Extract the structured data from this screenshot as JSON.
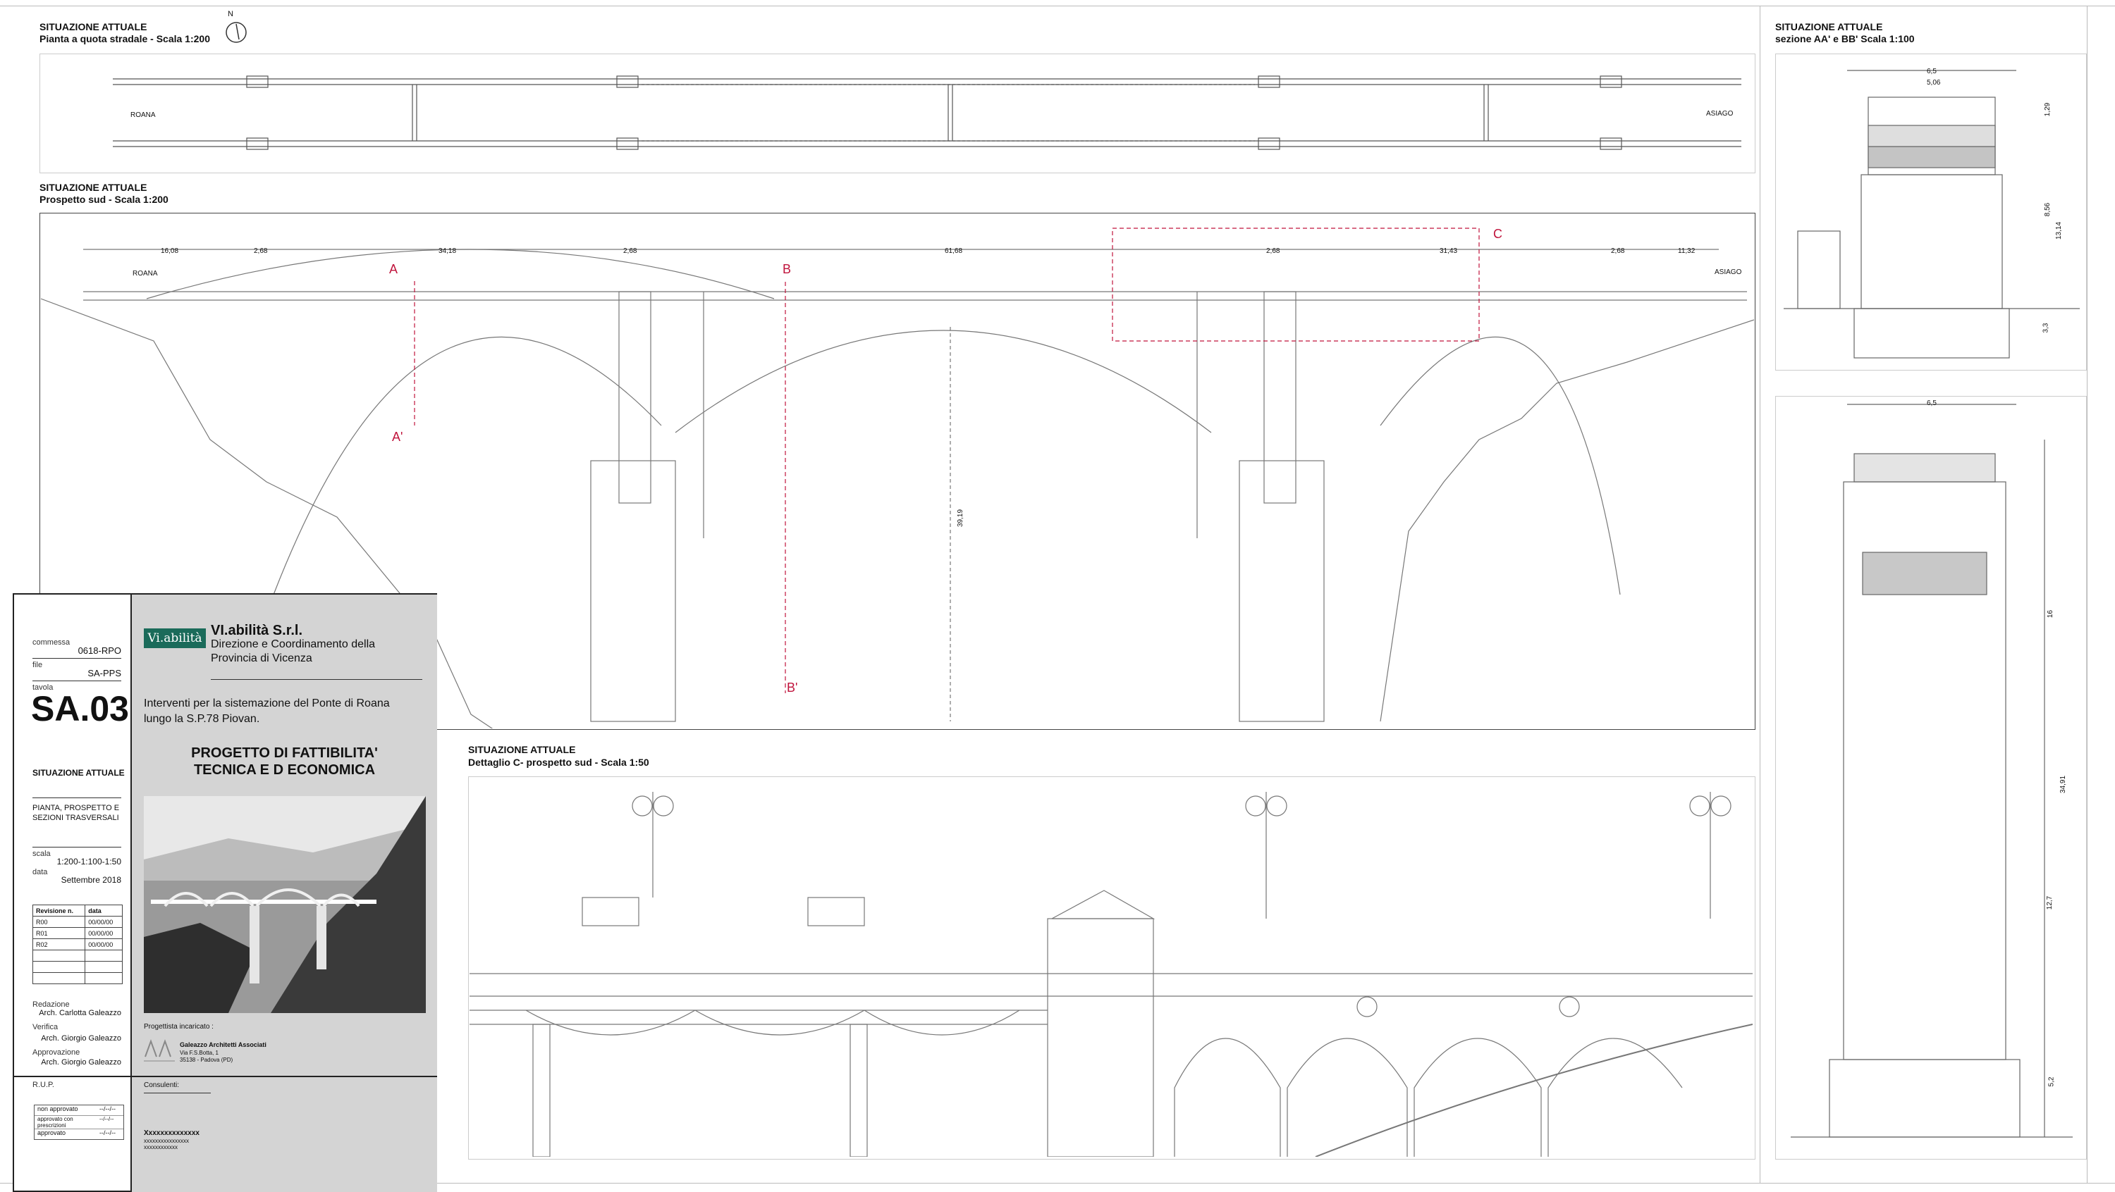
{
  "panels": {
    "plan": {
      "title": "SITUAZIONE ATTUALE",
      "subtitle": "Pianta a quota stradale - Scala 1:200",
      "left_label": "ROANA",
      "right_label": "ASIAGO",
      "north": "N"
    },
    "elevation": {
      "title": "SITUAZIONE ATTUALE",
      "subtitle": "Prospetto sud - Scala 1:200",
      "left_label": "ROANA",
      "right_label": "ASIAGO",
      "dims": [
        "16,08",
        "2,68",
        "34,18",
        "2,68",
        "61,68",
        "2,68",
        "31,43",
        "2,68",
        "11,32"
      ],
      "markers": {
        "a": "A",
        "a2": "A'",
        "b": "B",
        "b2": "B'",
        "c": "C"
      },
      "height_dim": "39,19"
    },
    "detail": {
      "title": "SITUAZIONE ATTUALE",
      "subtitle": "Dettaglio C- prospetto sud - Scala 1:50"
    },
    "section": {
      "title": "SITUAZIONE ATTUALE",
      "subtitle": "sezione AA' e BB'  Scala 1:100",
      "dims_top": [
        "6,5",
        "5,06"
      ],
      "dims_side": [
        "1,29",
        "8,56",
        "3,3",
        "13,14"
      ],
      "dims_lower": [
        "6,5",
        "16",
        "12,7",
        "34,91",
        "5,2"
      ]
    }
  },
  "titleblock": {
    "commessa_label": "commessa",
    "commessa": "0618-RPO",
    "file_label": "file",
    "file": "SA-PPS",
    "tavola_label": "tavola",
    "tavola": "SA.03",
    "subject_title": "SITUAZIONE ATTUALE",
    "subject_desc": "PIANTA, PROSPETTO E SEZIONI TRASVERSALI",
    "scala_label": "scala",
    "scala": "1:200-1:100-1:50",
    "data_label": "data",
    "data": "Settembre 2018",
    "revisions": {
      "header": [
        "Revisione n.",
        "data"
      ],
      "rows": [
        [
          "R00",
          "00/00/00"
        ],
        [
          "R01",
          "00/00/00"
        ],
        [
          "R02",
          "00/00/00"
        ],
        [
          "",
          ""
        ],
        [
          "",
          ""
        ],
        [
          "",
          ""
        ]
      ]
    },
    "redazione_label": "Redazione",
    "redazione": "Arch. Carlotta Galeazzo",
    "verifica_label": "Verifica",
    "verifica": "Arch. Giorgio Galeazzo",
    "approvazione_label": "Approvazione",
    "approvazione": "Arch. Giorgio Galeazzo",
    "rup_label": "R.U.P.",
    "approval_options": [
      "non approvato",
      "approvato con prescrizioni",
      "approvato"
    ],
    "approval_marks": [
      "--/--/--",
      "--/--/--",
      "--/--/--"
    ],
    "logo_text": "Vi.abilità",
    "company": "VI.abilità S.r.l.",
    "company_sub1": "Direzione e Coordinamento della",
    "company_sub2": "Provincia di Vicenza",
    "project_line1": "Interventi per la sistemazione del Ponte di Roana",
    "project_line2": "lungo la S.P.78 Piovan.",
    "project_type1": "PROGETTO DI FATTIBILITA'",
    "project_type2": "TECNICA E D ECONOMICA",
    "progettista_label": "Progettista incaricato :",
    "firm_name": "Galeazzo Architetti Associati",
    "firm_addr1": "Via F.S.Botta, 1",
    "firm_addr2": "35138 - Padova (PD)",
    "consulenti_label": "Consulenti:",
    "consulente": "Xxxxxxxxxxxxxx",
    "consulente_sub1": "xxxxxxxxxxxxxxxx",
    "consulente_sub2": "xxxxxxxxxxxx"
  },
  "colors": {
    "red_marker": "#c0143c",
    "teal_logo": "#1b6b5a",
    "title_bg": "#d4d4d4"
  }
}
